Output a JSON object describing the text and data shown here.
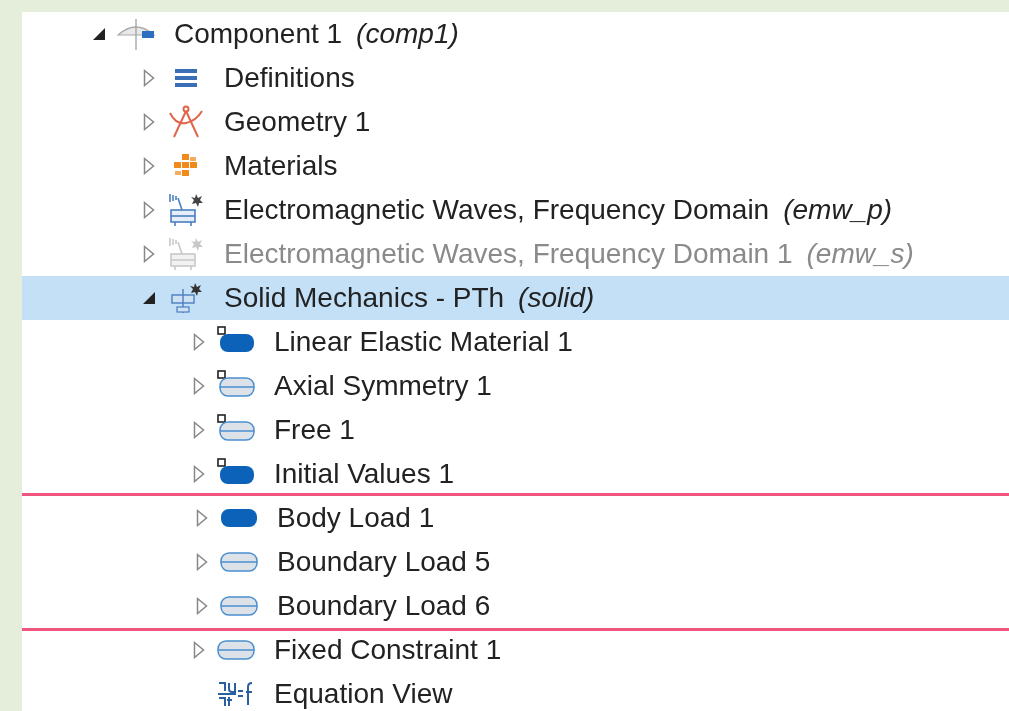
{
  "tree": [
    {
      "label": "Component 1",
      "tag": "(comp1)",
      "kind": "component",
      "expanded": true,
      "selected": false,
      "disabled": false,
      "highlighted": false,
      "children": [
        {
          "label": "Definitions",
          "kind": "definitions",
          "expanded": false,
          "selected": false,
          "disabled": false,
          "highlighted": false
        },
        {
          "label": "Geometry 1",
          "kind": "geometry",
          "expanded": false,
          "selected": false,
          "disabled": false,
          "highlighted": false
        },
        {
          "label": "Materials",
          "kind": "materials",
          "expanded": false,
          "selected": false,
          "disabled": false,
          "highlighted": false
        },
        {
          "label": "Electromagnetic Waves, Frequency Domain",
          "tag": "(emw_p)",
          "kind": "physics",
          "expanded": false,
          "selected": false,
          "disabled": false,
          "highlighted": false
        },
        {
          "label": "Electromagnetic Waves, Frequency Domain 1",
          "tag": "(emw_s)",
          "kind": "physics",
          "expanded": false,
          "selected": false,
          "disabled": true,
          "highlighted": false
        },
        {
          "label": "Solid Mechanics - PTh",
          "tag": "(solid)",
          "kind": "solid",
          "expanded": true,
          "selected": true,
          "disabled": false,
          "highlighted": false,
          "children": [
            {
              "label": "Linear Elastic Material 1",
              "kind": "domain-default",
              "expanded": false,
              "selected": false,
              "disabled": false,
              "highlighted": false
            },
            {
              "label": "Axial Symmetry 1",
              "kind": "boundary-default",
              "expanded": false,
              "selected": false,
              "disabled": false,
              "highlighted": false
            },
            {
              "label": "Free 1",
              "kind": "boundary-default",
              "expanded": false,
              "selected": false,
              "disabled": false,
              "highlighted": false
            },
            {
              "label": "Initial Values 1",
              "kind": "domain-default",
              "expanded": false,
              "selected": false,
              "disabled": false,
              "highlighted": false
            },
            {
              "label": "Body Load 1",
              "kind": "domain",
              "expanded": false,
              "selected": false,
              "disabled": false,
              "highlighted": true
            },
            {
              "label": "Boundary Load 5",
              "kind": "boundary",
              "expanded": false,
              "selected": false,
              "disabled": false,
              "highlighted": true
            },
            {
              "label": "Boundary Load 6",
              "kind": "boundary",
              "expanded": false,
              "selected": false,
              "disabled": false,
              "highlighted": true
            },
            {
              "label": "Fixed Constraint 1",
              "kind": "boundary",
              "expanded": false,
              "selected": false,
              "disabled": false,
              "highlighted": false
            },
            {
              "label": "Equation View",
              "kind": "equation",
              "selected": false,
              "disabled": false,
              "highlighted": false
            }
          ]
        }
      ]
    }
  ]
}
